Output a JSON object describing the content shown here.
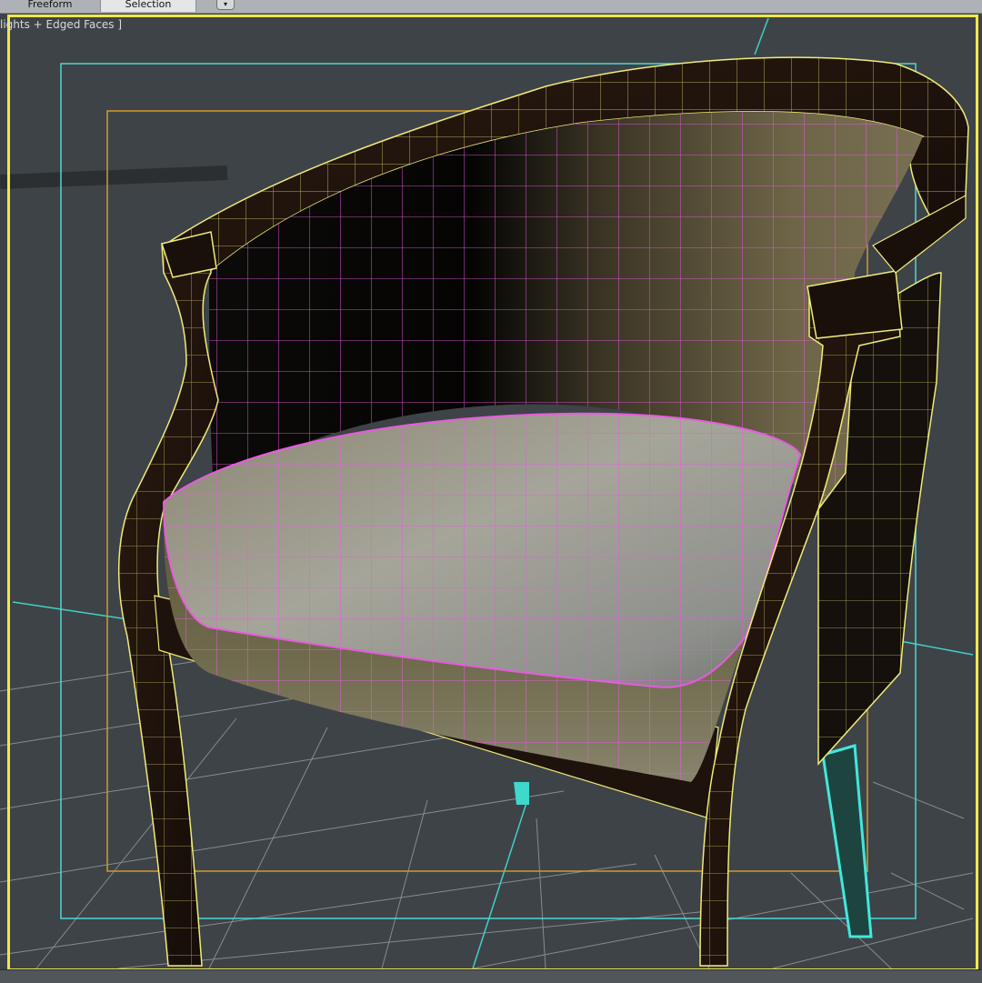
{
  "ribbon": {
    "tabs": [
      {
        "label": "Freeform"
      },
      {
        "label": "Selection",
        "active": true
      }
    ],
    "dropdown_icon": "chevron-down-icon"
  },
  "viewport": {
    "label": "lights + Edged Faces ]",
    "active_border_color": "#f2e64a",
    "safe_frame_color": "#4fd6d6",
    "render_frame_color": "#d49a2a",
    "seat_wire_color": "#e85ae0",
    "frame_wire_color": "#f0ec78"
  }
}
